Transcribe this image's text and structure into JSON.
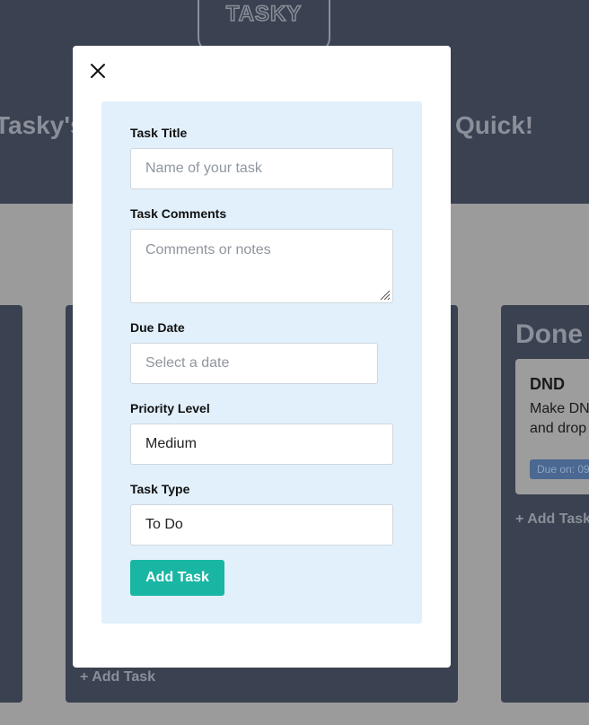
{
  "app": {
    "logo_text": "TASKY",
    "headline_left": "Tasky's",
    "headline_right": "Quick!"
  },
  "board": {
    "add_task_label": "+ Add Task",
    "add_task_label_truncated": "+ Add Task",
    "done_column": {
      "title": "Done",
      "card": {
        "title": "DND",
        "description": "Make DN\nand drop",
        "due_label": "Due on: 09"
      }
    }
  },
  "modal": {
    "close_icon": "close-icon",
    "fields": {
      "title": {
        "label": "Task Title",
        "placeholder": "Name of your task",
        "value": ""
      },
      "comments": {
        "label": "Task Comments",
        "placeholder": "Comments or notes",
        "value": ""
      },
      "due_date": {
        "label": "Due Date",
        "placeholder": "Select a date",
        "value": ""
      },
      "priority": {
        "label": "Priority Level",
        "value": "Medium"
      },
      "type": {
        "label": "Task Type",
        "value": "To Do"
      }
    },
    "submit_label": "Add Task"
  },
  "colors": {
    "header_bg": "#3a4150",
    "overlay": "#9b9b9b",
    "form_panel_bg": "#e1f0fb",
    "accent": "#18b6a3"
  }
}
